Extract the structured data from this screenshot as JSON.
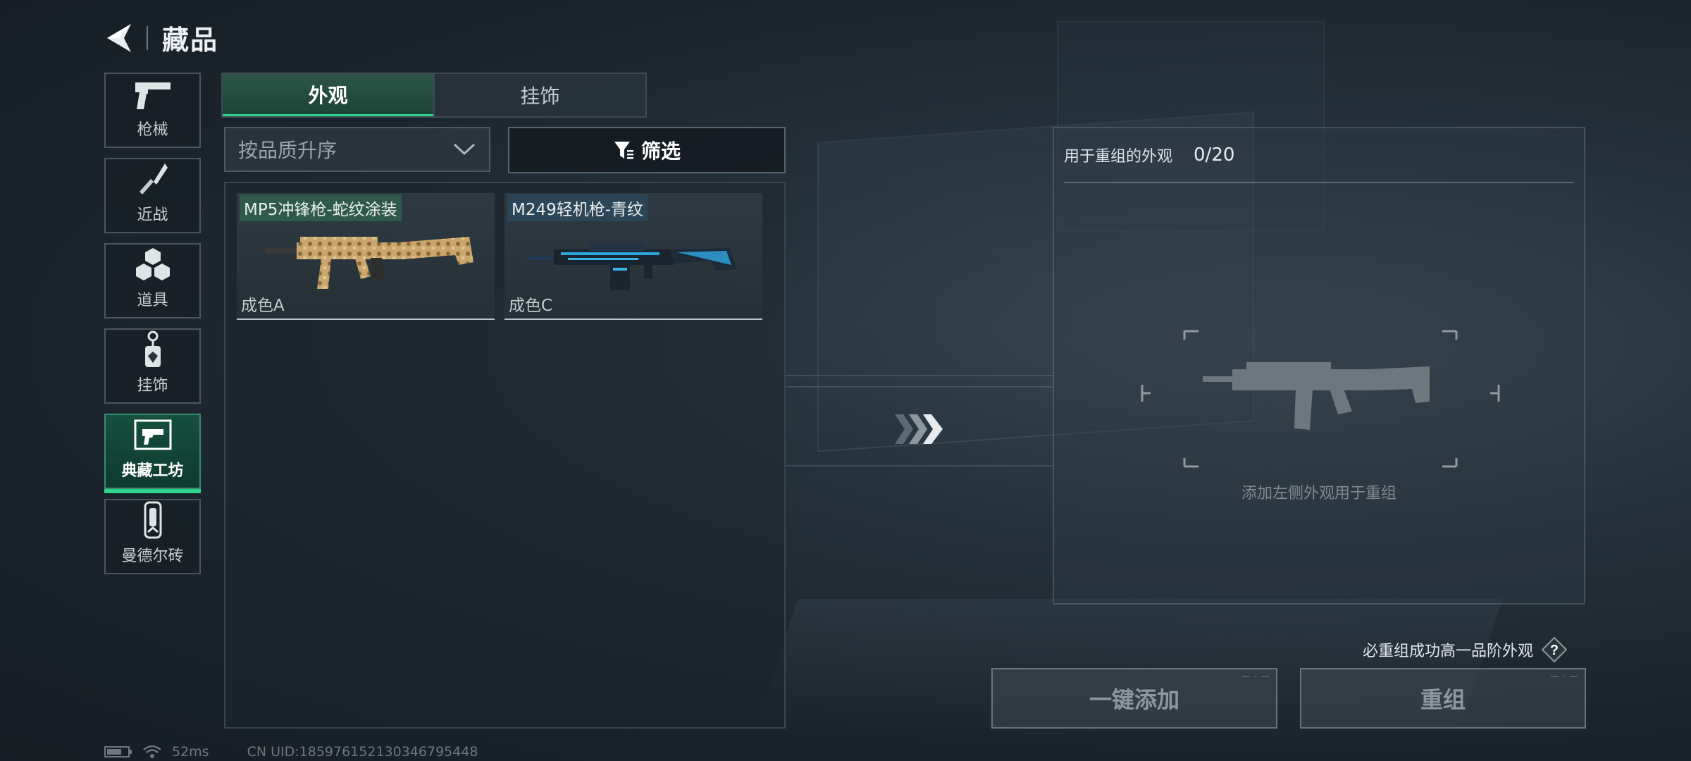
{
  "header": {
    "title": "藏品"
  },
  "sidebar": {
    "items": [
      {
        "label": "枪械",
        "icon": "pistol-icon"
      },
      {
        "label": "近战",
        "icon": "knife-icon"
      },
      {
        "label": "道具",
        "icon": "items-icon"
      },
      {
        "label": "挂饰",
        "icon": "charm-icon"
      },
      {
        "label": "典藏工坊",
        "icon": "workshop-icon",
        "active": true
      },
      {
        "label": "曼德尔砖",
        "icon": "brick-icon"
      }
    ]
  },
  "tabs": [
    {
      "label": "外观",
      "active": true
    },
    {
      "label": "挂饰",
      "active": false
    }
  ],
  "sort": {
    "label": "按品质升序"
  },
  "filter": {
    "label": "筛选"
  },
  "items": [
    {
      "name": "MP5冲锋枪-蛇纹涂装",
      "quality": "成色A",
      "tag_color": "#2f5a4b"
    },
    {
      "name": "M249轻机枪-青纹",
      "quality": "成色C",
      "tag_color": "#2c4659"
    }
  ],
  "recompose": {
    "label": "用于重组的外观",
    "count": "0/20",
    "hint": "添加左侧外观用于重组",
    "guarantee": "必重组成功高一品阶外观",
    "add_all_button": "一键添加",
    "recompose_button": "重组"
  },
  "status": {
    "ping": "52ms",
    "uid": "CN UID:185976152130346795448"
  },
  "colors": {
    "accent_green": "#2fd38d",
    "active_tab": "#2b5548"
  }
}
